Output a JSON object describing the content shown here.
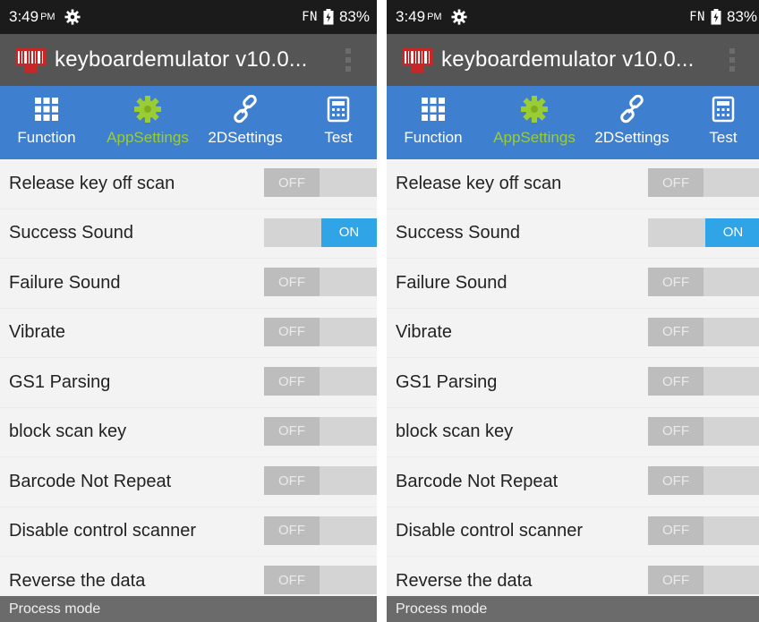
{
  "status_bar": {
    "time": "3:49",
    "ampm": "PM",
    "fn_label": "FN",
    "battery": "83%"
  },
  "app_bar": {
    "title": "keyboardemulator v10.0..."
  },
  "tabs": [
    {
      "label": "Function",
      "icon": "grid-icon",
      "active": false
    },
    {
      "label": "AppSettings",
      "icon": "gear-icon",
      "active": true
    },
    {
      "label": "2DSettings",
      "icon": "link-icon",
      "active": false
    },
    {
      "label": "Test",
      "icon": "calculator-icon",
      "active": false
    }
  ],
  "settings": [
    {
      "label": "Release key off scan",
      "state": "OFF"
    },
    {
      "label": "Success Sound",
      "state": "ON"
    },
    {
      "label": "Failure Sound",
      "state": "OFF"
    },
    {
      "label": "Vibrate",
      "state": "OFF"
    },
    {
      "label": "GS1 Parsing",
      "state": "OFF"
    },
    {
      "label": "block scan key",
      "state": "OFF"
    },
    {
      "label": "Barcode Not Repeat",
      "state": "OFF"
    },
    {
      "label": "Disable control scanner",
      "state": "OFF"
    },
    {
      "label": "Reverse the data",
      "state": "OFF"
    }
  ],
  "section_header": "Process mode",
  "colors": {
    "tab_bar": "#3f7fd0",
    "active_tab": "#9acd32",
    "toggle_on": "#2fa4e7",
    "app_bar": "#555555"
  }
}
